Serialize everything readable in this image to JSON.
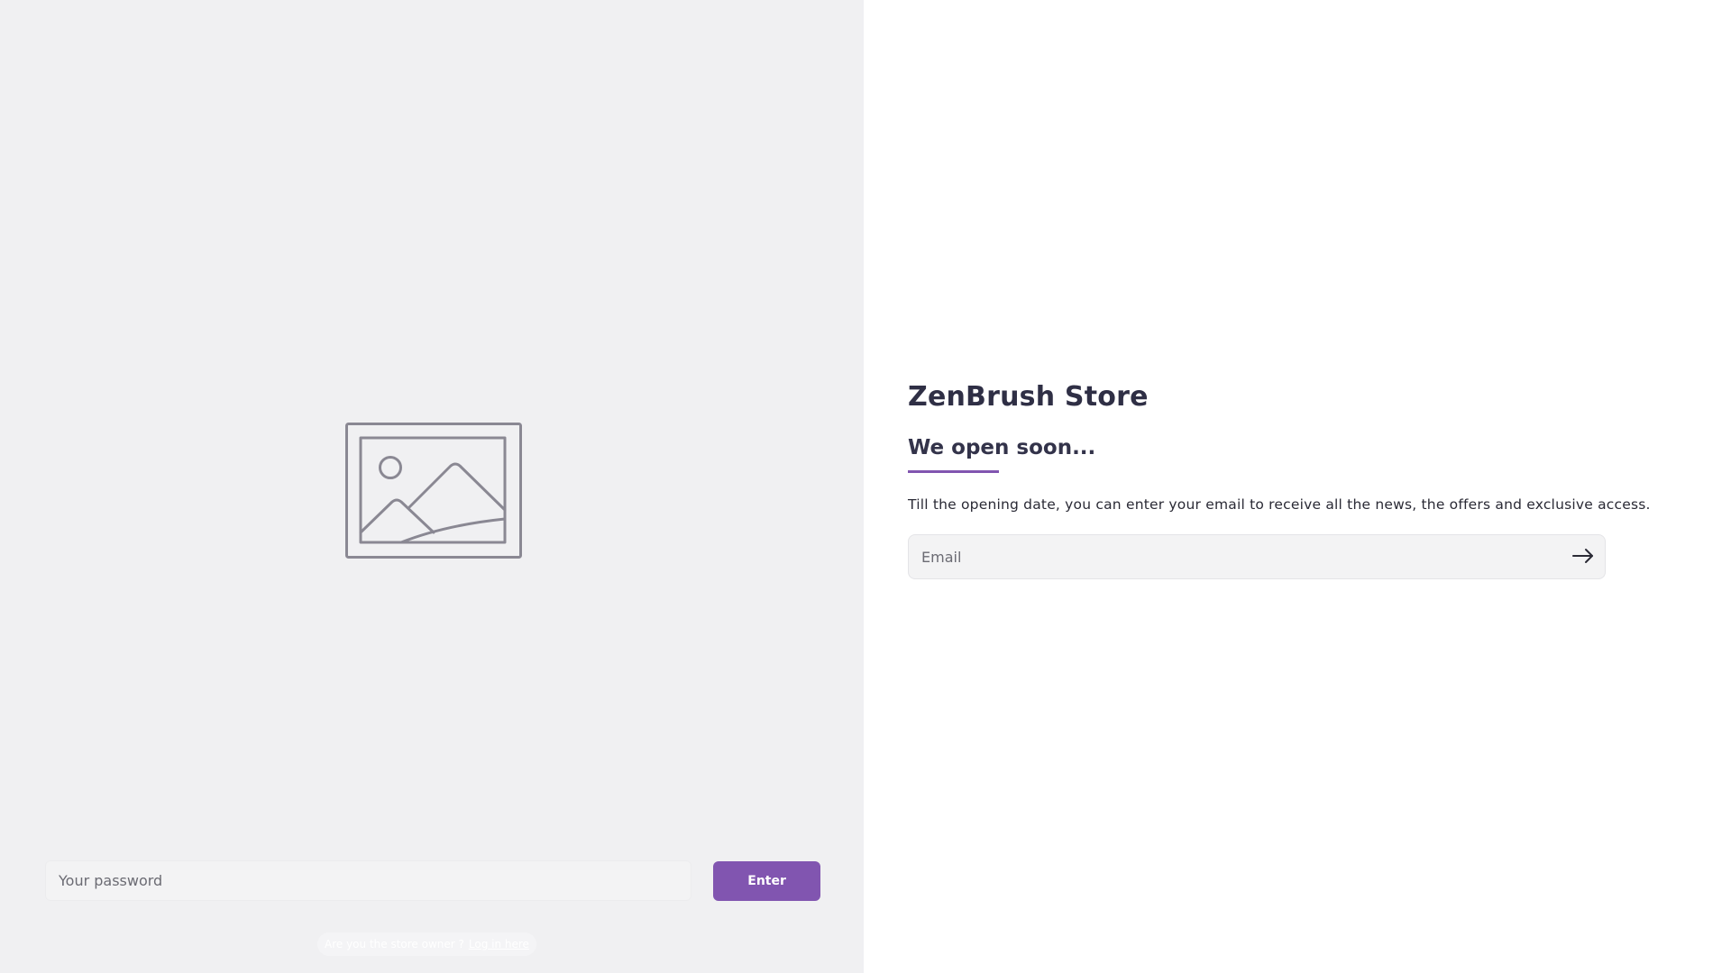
{
  "store": {
    "name": "ZenBrush Store",
    "heading": "We open soon...",
    "description": "Till the opening date, you can enter your email to receive all the news, the offers and exclusive access."
  },
  "newsletter": {
    "email_placeholder": "Email",
    "submit_icon": "arrow-right-icon"
  },
  "password": {
    "placeholder": "Your password",
    "enter_label": "Enter",
    "owner_question": "Are you the store owner ?",
    "owner_link": "Log in here"
  },
  "media": {
    "placeholder_icon": "image-placeholder-icon"
  },
  "colors": {
    "accent": "#8155b0",
    "left_panel_bg": "#f0f0f2",
    "title_text": "#2f2f45"
  }
}
